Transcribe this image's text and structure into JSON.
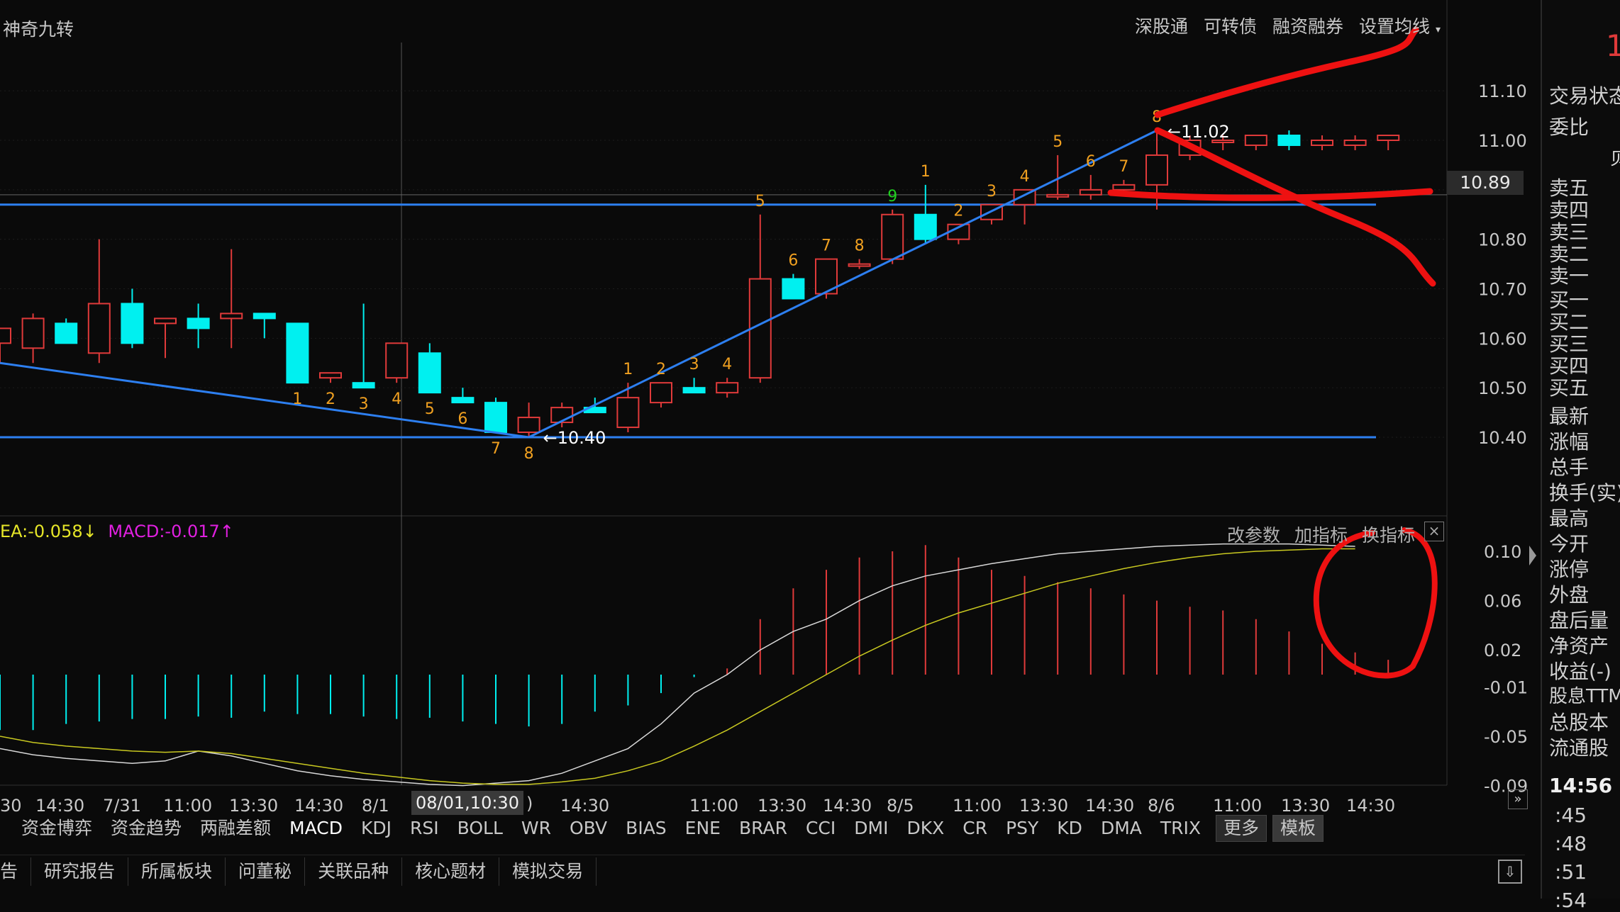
{
  "window": {
    "indicator_name": "神奇九转",
    "top_links": [
      "深股通",
      "可转债",
      "融资融券",
      "设置均线"
    ]
  },
  "price_axis": {
    "labels": [
      "11.10",
      "11.00",
      "10.90",
      "10.80",
      "10.70",
      "10.60",
      "10.50",
      "10.40"
    ],
    "current_price": "10.89"
  },
  "price_annotations": {
    "high": "11.02",
    "low": "10.40"
  },
  "macd_panel": {
    "legend_dea": "EA:-0.058",
    "legend_dea_arrow": "↓",
    "legend_macd": "MACD:-0.017",
    "legend_macd_arrow": "↑",
    "toolbar": [
      "改参数",
      "加指标",
      "换指标"
    ],
    "close": "×",
    "axis_labels": [
      "0.10",
      "0.06",
      "0.02",
      "-0.01",
      "-0.05",
      "-0.09"
    ]
  },
  "time_axis": {
    "labels": [
      "30",
      "14:30",
      "7/31",
      "11:00",
      "13:30",
      "14:30",
      "8/1",
      "14:30",
      "11:00",
      "13:30",
      "14:30",
      "8/5",
      "11:00",
      "13:30",
      "14:30",
      "8/6",
      "11:00",
      "13:30",
      "14:30"
    ],
    "cursor_label": "08/01,10:30",
    "cursor_fragment": ")"
  },
  "indicator_tabs": [
    "资金博弈",
    "资金趋势",
    "两融差额",
    "MACD",
    "KDJ",
    "RSI",
    "BOLL",
    "WR",
    "OBV",
    "BIAS",
    "ENE",
    "BRAR",
    "CCI",
    "DMI",
    "DKX",
    "CR",
    "PSY",
    "KD",
    "DMA",
    "TRIX",
    "更多",
    "模板"
  ],
  "active_tab": "MACD",
  "bottom_tabs": [
    "告",
    "研究报告",
    "所属板块",
    "问董秘",
    "关联品种",
    "核心题材",
    "模拟交易"
  ],
  "right_panel": {
    "items": [
      "交易状态",
      "委比",
      "卖五",
      "卖四",
      "卖三",
      "卖二",
      "卖一",
      "买一",
      "买二",
      "买三",
      "买四",
      "买五",
      "最新",
      "涨幅",
      "总手",
      "换手(实)",
      "最高",
      "今开",
      "涨停",
      "外盘",
      "盘后量",
      "净资产",
      "收益(-)",
      "股息TTM",
      "总股本",
      "流通股"
    ],
    "time": "14:56",
    "ticks": [
      ":45",
      ":48",
      ":51",
      ":54"
    ],
    "corner_digit": "1",
    "corner_glyph": "贝"
  },
  "colors": {
    "up": "#e03a3a",
    "down": "#00f0f0",
    "count_orange": "#f0a020",
    "count_green": "#20d020",
    "trendline": "#2d7ff0",
    "dif": "#d8d8d8",
    "dea": "#c8c820",
    "macd_label": "#e020e0",
    "annotation_red": "#ee1111"
  },
  "chart_data": {
    "type": "candlestick",
    "candles": [
      {
        "o": 10.59,
        "h": 10.59,
        "l": 10.55,
        "c": 10.62
      },
      {
        "o": 10.58,
        "h": 10.65,
        "l": 10.55,
        "c": 10.64
      },
      {
        "o": 10.63,
        "h": 10.64,
        "l": 10.59,
        "c": 10.59
      },
      {
        "o": 10.57,
        "h": 10.8,
        "l": 10.55,
        "c": 10.67
      },
      {
        "o": 10.67,
        "h": 10.7,
        "l": 10.58,
        "c": 10.59
      },
      {
        "o": 10.63,
        "h": 10.64,
        "l": 10.56,
        "c": 10.64
      },
      {
        "o": 10.64,
        "h": 10.67,
        "l": 10.58,
        "c": 10.62
      },
      {
        "o": 10.64,
        "h": 10.78,
        "l": 10.58,
        "c": 10.65
      },
      {
        "o": 10.65,
        "h": 10.65,
        "l": 10.6,
        "c": 10.64
      },
      {
        "o": 10.63,
        "h": 10.63,
        "l": 10.51,
        "c": 10.51
      },
      {
        "o": 10.52,
        "h": 10.53,
        "l": 10.51,
        "c": 10.53
      },
      {
        "o": 10.51,
        "h": 10.67,
        "l": 10.5,
        "c": 10.5
      },
      {
        "o": 10.52,
        "h": 10.59,
        "l": 10.51,
        "c": 10.59
      },
      {
        "o": 10.57,
        "h": 10.59,
        "l": 10.49,
        "c": 10.49
      },
      {
        "o": 10.48,
        "h": 10.5,
        "l": 10.47,
        "c": 10.47
      },
      {
        "o": 10.47,
        "h": 10.48,
        "l": 10.41,
        "c": 10.41
      },
      {
        "o": 10.41,
        "h": 10.47,
        "l": 10.4,
        "c": 10.44
      },
      {
        "o": 10.43,
        "h": 10.47,
        "l": 10.42,
        "c": 10.46
      },
      {
        "o": 10.46,
        "h": 10.48,
        "l": 10.45,
        "c": 10.45
      },
      {
        "o": 10.42,
        "h": 10.51,
        "l": 10.41,
        "c": 10.48
      },
      {
        "o": 10.47,
        "h": 10.51,
        "l": 10.46,
        "c": 10.51
      },
      {
        "o": 10.5,
        "h": 10.52,
        "l": 10.49,
        "c": 10.49
      },
      {
        "o": 10.49,
        "h": 10.52,
        "l": 10.48,
        "c": 10.51
      },
      {
        "o": 10.52,
        "h": 10.85,
        "l": 10.51,
        "c": 10.72
      },
      {
        "o": 10.72,
        "h": 10.73,
        "l": 10.68,
        "c": 10.68
      },
      {
        "o": 10.69,
        "h": 10.76,
        "l": 10.68,
        "c": 10.76
      },
      {
        "o": 10.75,
        "h": 10.76,
        "l": 10.74,
        "c": 10.75
      },
      {
        "o": 10.76,
        "h": 10.86,
        "l": 10.75,
        "c": 10.85
      },
      {
        "o": 10.85,
        "h": 10.91,
        "l": 10.79,
        "c": 10.8
      },
      {
        "o": 10.8,
        "h": 10.83,
        "l": 10.79,
        "c": 10.83
      },
      {
        "o": 10.84,
        "h": 10.87,
        "l": 10.83,
        "c": 10.87
      },
      {
        "o": 10.87,
        "h": 10.9,
        "l": 10.83,
        "c": 10.9
      },
      {
        "o": 10.89,
        "h": 10.97,
        "l": 10.88,
        "c": 10.89
      },
      {
        "o": 10.89,
        "h": 10.93,
        "l": 10.88,
        "c": 10.9
      },
      {
        "o": 10.9,
        "h": 10.92,
        "l": 10.89,
        "c": 10.91
      },
      {
        "o": 10.91,
        "h": 11.02,
        "l": 10.86,
        "c": 10.97
      },
      {
        "o": 10.97,
        "h": 11.01,
        "l": 10.96,
        "c": 11.0
      },
      {
        "o": 11.0,
        "h": 11.01,
        "l": 10.98,
        "c": 11.0
      },
      {
        "o": 10.99,
        "h": 11.01,
        "l": 10.98,
        "c": 11.01
      },
      {
        "o": 11.01,
        "h": 11.02,
        "l": 10.98,
        "c": 10.99
      },
      {
        "o": 10.99,
        "h": 11.01,
        "l": 10.98,
        "c": 11.0
      },
      {
        "o": 10.99,
        "h": 11.01,
        "l": 10.98,
        "c": 11.0
      },
      {
        "o": 11.0,
        "h": 11.01,
        "l": 10.98,
        "c": 11.01
      }
    ],
    "td_counts": [
      {
        "i": 9,
        "n": "1",
        "pos": "below",
        "color": "orange"
      },
      {
        "i": 10,
        "n": "2",
        "pos": "below",
        "color": "orange"
      },
      {
        "i": 11,
        "n": "3",
        "pos": "below",
        "color": "orange"
      },
      {
        "i": 12,
        "n": "4",
        "pos": "below",
        "color": "orange"
      },
      {
        "i": 13,
        "n": "5",
        "pos": "below",
        "color": "orange"
      },
      {
        "i": 14,
        "n": "6",
        "pos": "below",
        "color": "orange"
      },
      {
        "i": 15,
        "n": "7",
        "pos": "below",
        "color": "orange"
      },
      {
        "i": 16,
        "n": "8",
        "pos": "below",
        "color": "orange"
      },
      {
        "i": 19,
        "n": "1",
        "pos": "above",
        "color": "orange"
      },
      {
        "i": 20,
        "n": "2",
        "pos": "above",
        "color": "orange"
      },
      {
        "i": 21,
        "n": "3",
        "pos": "above",
        "color": "orange"
      },
      {
        "i": 22,
        "n": "4",
        "pos": "above",
        "color": "orange"
      },
      {
        "i": 23,
        "n": "5",
        "pos": "above",
        "color": "orange"
      },
      {
        "i": 24,
        "n": "6",
        "pos": "above",
        "color": "orange"
      },
      {
        "i": 25,
        "n": "7",
        "pos": "above",
        "color": "orange"
      },
      {
        "i": 26,
        "n": "8",
        "pos": "above",
        "color": "orange"
      },
      {
        "i": 27,
        "n": "9",
        "pos": "above",
        "color": "green"
      },
      {
        "i": 28,
        "n": "1",
        "pos": "above",
        "color": "orange"
      },
      {
        "i": 29,
        "n": "2",
        "pos": "above",
        "color": "orange"
      },
      {
        "i": 30,
        "n": "3",
        "pos": "above",
        "color": "orange"
      },
      {
        "i": 31,
        "n": "4",
        "pos": "above",
        "color": "orange"
      },
      {
        "i": 32,
        "n": "5",
        "pos": "above",
        "color": "orange"
      },
      {
        "i": 33,
        "n": "6",
        "pos": "above",
        "color": "orange"
      },
      {
        "i": 34,
        "n": "7",
        "pos": "above",
        "color": "orange"
      },
      {
        "i": 35,
        "n": "8",
        "pos": "above",
        "color": "orange"
      }
    ],
    "macd": {
      "hist": [
        -0.045,
        -0.045,
        -0.04,
        -0.038,
        -0.036,
        -0.036,
        -0.034,
        -0.035,
        -0.03,
        -0.032,
        -0.032,
        -0.034,
        -0.036,
        -0.035,
        -0.038,
        -0.04,
        -0.042,
        -0.04,
        -0.03,
        -0.025,
        -0.015,
        -0.002,
        0.005,
        0.045,
        0.07,
        0.085,
        0.095,
        0.1,
        0.105,
        0.095,
        0.085,
        0.08,
        0.075,
        0.07,
        0.065,
        0.06,
        0.055,
        0.052,
        0.045,
        0.035,
        0.025,
        0.018,
        0.012
      ],
      "dif": [
        -0.06,
        -0.065,
        -0.068,
        -0.07,
        -0.072,
        -0.07,
        -0.062,
        -0.066,
        -0.072,
        -0.078,
        -0.082,
        -0.085,
        -0.087,
        -0.089,
        -0.09,
        -0.088,
        -0.086,
        -0.08,
        -0.07,
        -0.06,
        -0.04,
        -0.015,
        0.0,
        0.02,
        0.035,
        0.045,
        0.06,
        0.072,
        0.08,
        0.085,
        0.09,
        0.094,
        0.098,
        0.1,
        0.102,
        0.104,
        0.105,
        0.106,
        0.106,
        0.106,
        0.105,
        0.104
      ],
      "dea": [
        -0.05,
        -0.055,
        -0.058,
        -0.06,
        -0.062,
        -0.063,
        -0.062,
        -0.064,
        -0.068,
        -0.072,
        -0.076,
        -0.08,
        -0.083,
        -0.086,
        -0.088,
        -0.089,
        -0.089,
        -0.087,
        -0.084,
        -0.078,
        -0.07,
        -0.058,
        -0.045,
        -0.03,
        -0.015,
        0.0,
        0.015,
        0.028,
        0.04,
        0.05,
        0.058,
        0.066,
        0.074,
        0.08,
        0.086,
        0.091,
        0.095,
        0.098,
        0.1,
        0.101,
        0.102,
        0.102
      ]
    }
  }
}
